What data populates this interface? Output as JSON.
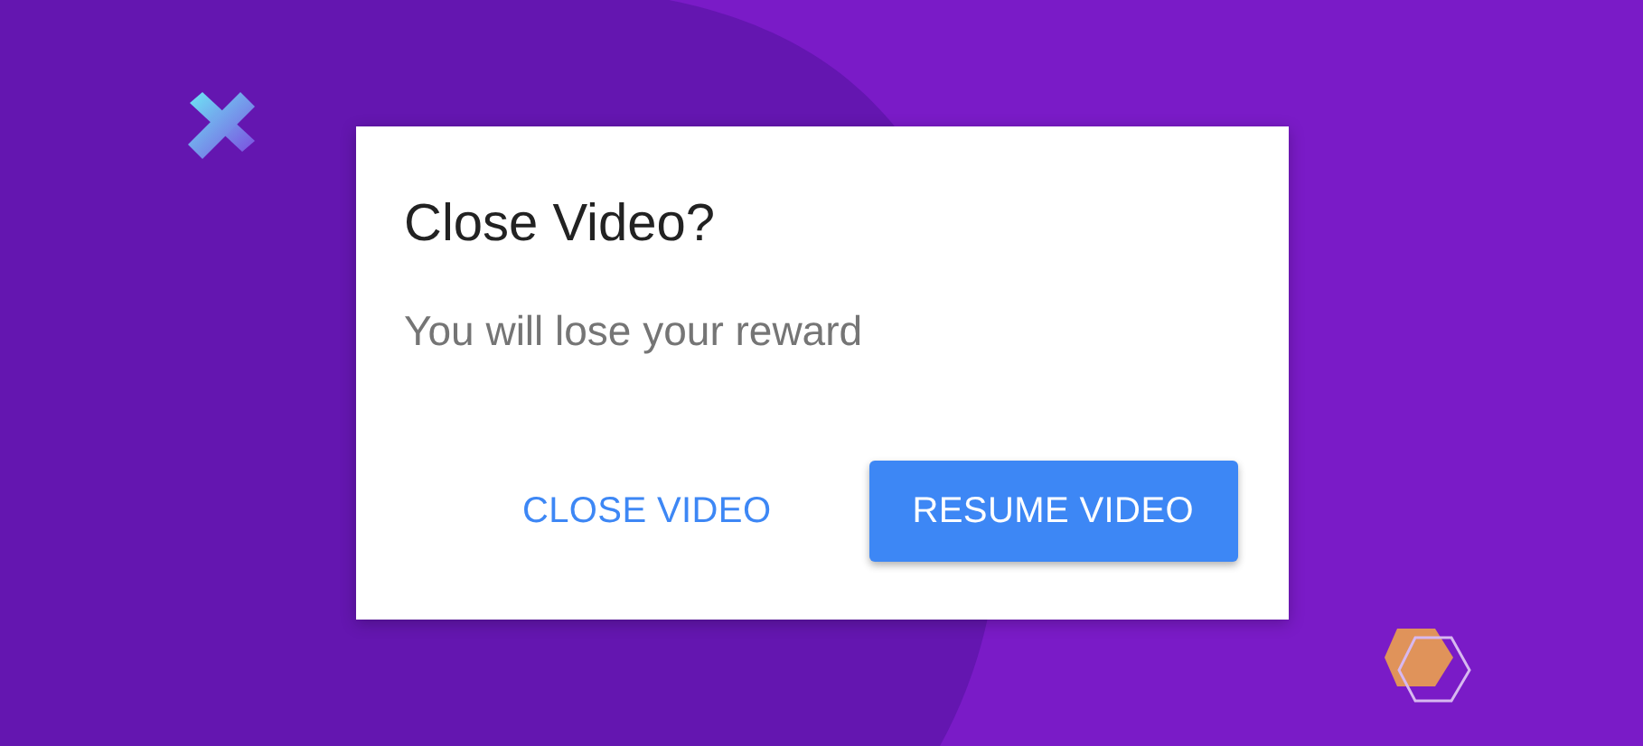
{
  "dialog": {
    "title": "Close Video?",
    "message": "You will lose your reward",
    "buttons": [
      {
        "label": "CLOSE VIDEO",
        "kind": "text"
      },
      {
        "label": "RESUME VIDEO",
        "kind": "contained"
      }
    ]
  }
}
